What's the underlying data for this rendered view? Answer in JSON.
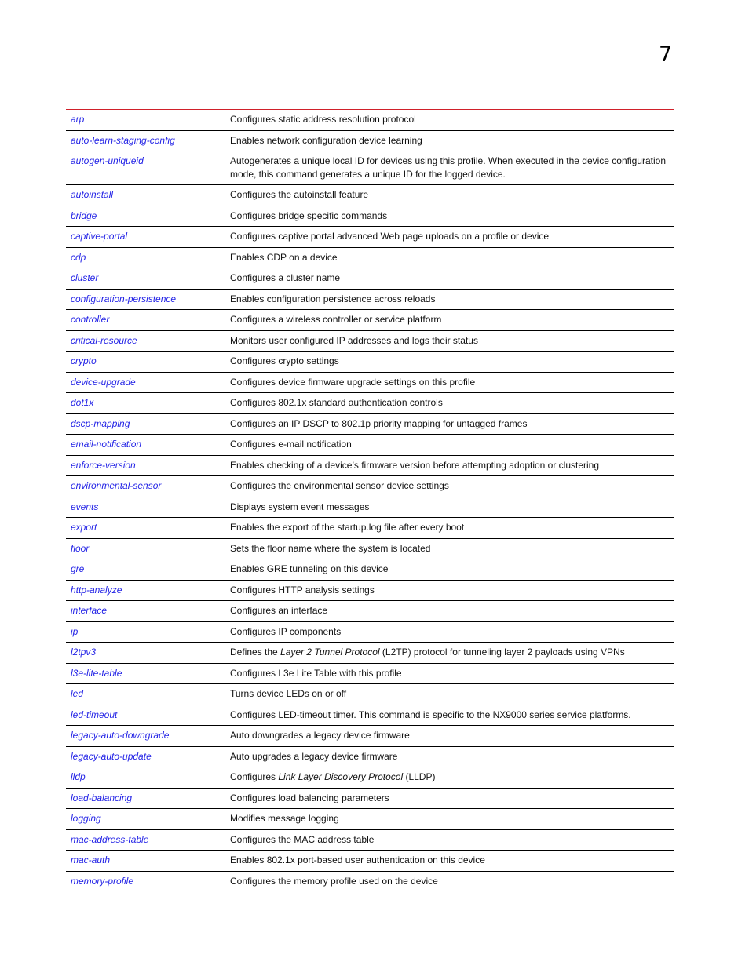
{
  "chapter_number": "7",
  "rows": [
    {
      "cmd": "arp",
      "desc": [
        {
          "t": "Configures static address resolution protocol"
        }
      ]
    },
    {
      "cmd": "auto-learn-staging-config",
      "desc": [
        {
          "t": "Enables network configuration device learning"
        }
      ]
    },
    {
      "cmd": "autogen-uniqueid",
      "desc": [
        {
          "t": "Autogenerates a unique local ID for devices using this profile. When executed in the device configuration mode, this command generates a unique ID for the logged device."
        }
      ]
    },
    {
      "cmd": "autoinstall",
      "desc": [
        {
          "t": "Configures the autoinstall feature"
        }
      ]
    },
    {
      "cmd": "bridge",
      "desc": [
        {
          "t": "Configures bridge specific commands"
        }
      ]
    },
    {
      "cmd": "captive-portal",
      "desc": [
        {
          "t": "Configures captive portal advanced Web page uploads on a profile or device"
        }
      ]
    },
    {
      "cmd": "cdp",
      "desc": [
        {
          "t": "Enables CDP on a device"
        }
      ]
    },
    {
      "cmd": "cluster",
      "desc": [
        {
          "t": "Configures a cluster name"
        }
      ]
    },
    {
      "cmd": "configuration-persistence",
      "desc": [
        {
          "t": "Enables configuration persistence across reloads"
        }
      ]
    },
    {
      "cmd": "controller",
      "desc": [
        {
          "t": "Configures a wireless controller or service platform"
        }
      ]
    },
    {
      "cmd": "critical-resource",
      "desc": [
        {
          "t": "Monitors user configured IP addresses and logs their status"
        }
      ]
    },
    {
      "cmd": "crypto",
      "desc": [
        {
          "t": "Configures crypto settings"
        }
      ]
    },
    {
      "cmd": "device-upgrade",
      "desc": [
        {
          "t": "Configures device firmware upgrade settings on this profile"
        }
      ]
    },
    {
      "cmd": "dot1x",
      "desc": [
        {
          "t": "Configures 802.1x standard authentication controls"
        }
      ]
    },
    {
      "cmd": "dscp-mapping",
      "desc": [
        {
          "t": "Configures an IP DSCP to 802.1p priority mapping for untagged frames"
        }
      ]
    },
    {
      "cmd": "email-notification",
      "desc": [
        {
          "t": "Configures e-mail notification"
        }
      ]
    },
    {
      "cmd": "enforce-version",
      "desc": [
        {
          "t": "Enables checking of a device’s firmware version before attempting adoption or clustering"
        }
      ]
    },
    {
      "cmd": "environmental-sensor",
      "desc": [
        {
          "t": "Configures the environmental sensor device settings"
        }
      ]
    },
    {
      "cmd": "events",
      "desc": [
        {
          "t": "Displays system event messages"
        }
      ]
    },
    {
      "cmd": "export",
      "desc": [
        {
          "t": "Enables the export of the startup.log file after every boot"
        }
      ]
    },
    {
      "cmd": "floor",
      "desc": [
        {
          "t": "Sets the floor name where the system is located"
        }
      ]
    },
    {
      "cmd": "gre",
      "desc": [
        {
          "t": "Enables GRE tunneling on this device"
        }
      ]
    },
    {
      "cmd": "http-analyze",
      "desc": [
        {
          "t": "Configures HTTP analysis settings"
        }
      ]
    },
    {
      "cmd": "interface",
      "desc": [
        {
          "t": "Configures an interface"
        }
      ]
    },
    {
      "cmd": "ip",
      "desc": [
        {
          "t": "Configures IP components"
        }
      ]
    },
    {
      "cmd": "l2tpv3",
      "desc": [
        {
          "t": "Defines the "
        },
        {
          "t": "Layer 2 Tunnel Protocol",
          "i": true
        },
        {
          "t": " (L2TP) protocol for tunneling layer 2 payloads using VPNs"
        }
      ]
    },
    {
      "cmd": "l3e-lite-table",
      "desc": [
        {
          "t": "Configures L3e Lite Table with this profile"
        }
      ]
    },
    {
      "cmd": "led",
      "desc": [
        {
          "t": "Turns device LEDs on or off"
        }
      ]
    },
    {
      "cmd": "led-timeout",
      "desc": [
        {
          "t": "Configures LED-timeout timer. This command is specific to the NX9000 series service platforms."
        }
      ]
    },
    {
      "cmd": "legacy-auto-downgrade",
      "desc": [
        {
          "t": "Auto downgrades a legacy device firmware"
        }
      ]
    },
    {
      "cmd": "legacy-auto-update",
      "desc": [
        {
          "t": "Auto upgrades a legacy device firmware"
        }
      ]
    },
    {
      "cmd": "lldp",
      "desc": [
        {
          "t": "Configures "
        },
        {
          "t": "Link Layer Discovery Protocol",
          "i": true
        },
        {
          "t": " (LLDP)"
        }
      ]
    },
    {
      "cmd": "load-balancing",
      "desc": [
        {
          "t": "Configures load balancing parameters"
        }
      ]
    },
    {
      "cmd": "logging",
      "desc": [
        {
          "t": "Modifies message logging"
        }
      ]
    },
    {
      "cmd": "mac-address-table",
      "desc": [
        {
          "t": "Configures the MAC address table"
        }
      ]
    },
    {
      "cmd": "mac-auth",
      "desc": [
        {
          "t": "Enables 802.1x port-based user authentication on this device"
        }
      ]
    },
    {
      "cmd": "memory-profile",
      "desc": [
        {
          "t": "Configures the memory profile used on the device"
        }
      ]
    }
  ]
}
